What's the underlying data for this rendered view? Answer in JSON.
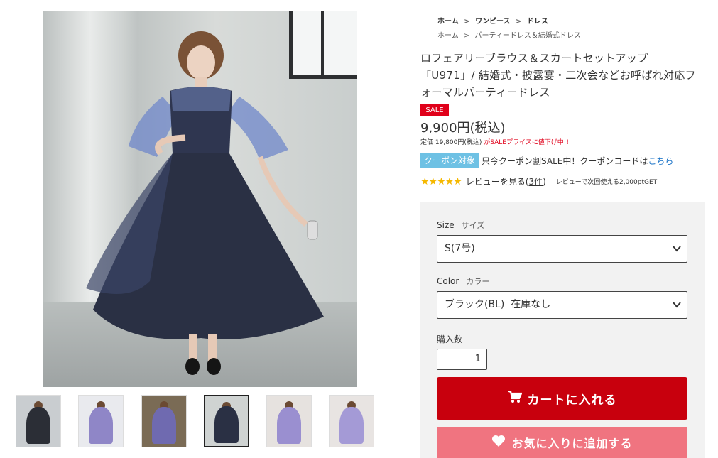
{
  "breadcrumb": {
    "row1": [
      "ホーム",
      "ワンピース",
      "ドレス"
    ],
    "row2": [
      "ホーム",
      "パーティードレス＆結婚式ドレス"
    ],
    "separator": ">"
  },
  "product": {
    "title": "ロフェアリーブラウス＆スカートセットアップ「U971」/ 結婚式・披露宴・二次会などお呼ばれ対応フォーマルパーティードレス",
    "sale_badge": "SALE",
    "price": "9,900円(税込)",
    "price_note_regular": "定価 19,800円(税込)",
    "price_note_red": "がSALEプライスに値下げ中!!",
    "coupon_tag": "クーポン対象",
    "coupon_text": "只今クーポン割SALE中！クーポンコードは",
    "coupon_link": "こちら",
    "stars": "★★★★★",
    "review_prefix": "レビューを見る(",
    "review_count": "3件",
    "review_suffix": ")",
    "review_extra": "レビューで次回使える2,000ptGET"
  },
  "options": {
    "size_label": "Size",
    "size_sub": "サイズ",
    "size_value": "S(7号)",
    "color_label": "Color",
    "color_sub": "カラー",
    "color_value": "ブラック(BL)  在庫なし",
    "qty_label": "購入数",
    "qty_value": "1",
    "cart_button": "カートに入れる",
    "fav_button": "お気に入りに追加する"
  },
  "thumbnails": [
    {
      "name": "thumb-1",
      "dress": "#2b2e36"
    },
    {
      "name": "thumb-2",
      "dress": "#8f86c7"
    },
    {
      "name": "thumb-3",
      "dress": "#6f6ab0"
    },
    {
      "name": "thumb-4",
      "dress": "#2a3044",
      "active": true
    },
    {
      "name": "thumb-5",
      "dress": "#9a8fd0"
    },
    {
      "name": "thumb-6",
      "dress": "#a49ad6"
    }
  ],
  "colors": {
    "accent_red": "#c8000d",
    "sale_red": "#e0001a",
    "fav_pink": "#f07480",
    "coupon_blue": "#6ec1e4",
    "star_gold": "#f5b800",
    "dress_navy": "#2a3044"
  },
  "icons": {
    "cart": "cart-icon",
    "heart": "heart-icon",
    "chevron": "chevron-down-icon"
  }
}
